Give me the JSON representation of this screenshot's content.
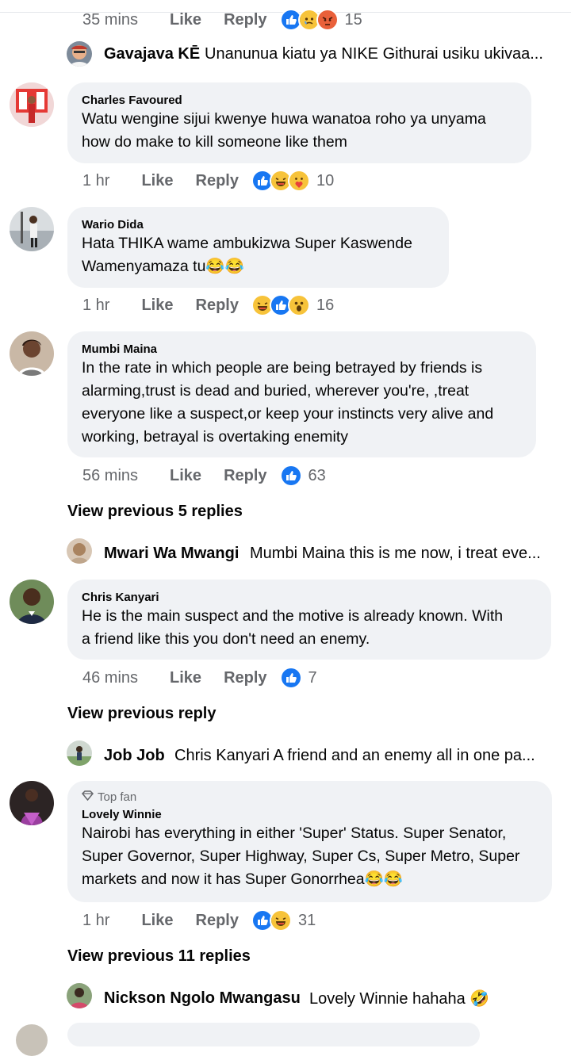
{
  "comments": [
    {
      "id": "charles",
      "name": "Charles Favoured",
      "text": "Watu wengine sijui kwenye huwa wanatoa roho ya unyama\nhow do make to kill someone like them",
      "time": "1 hr",
      "like": "Like",
      "reply": "Reply",
      "reactions": [
        "like-reaction",
        "haha-reaction",
        "care-reaction"
      ],
      "count": "10"
    },
    {
      "id": "wario",
      "name": "Wario Dida",
      "text": "Hata THIKA wame ambukizwa Super Kaswende\nWamenyamaza tu😂😂",
      "time": "1 hr",
      "like": "Like",
      "reply": "Reply",
      "reactions": [
        "haha-reaction",
        "like-reaction",
        "wow-reaction"
      ],
      "count": "16"
    },
    {
      "id": "mumbi",
      "name": "Mumbi Maina",
      "text": "In the rate in which people are being betrayed by friends is\nalarming,trust is dead and buried, wherever you're, ,treat\neveryone like a suspect,or keep your instincts very alive and\nworking, betrayal is overtaking enemity",
      "time": "56 mins",
      "like": "Like",
      "reply": "Reply",
      "reactions": [
        "like-reaction"
      ],
      "count": "63"
    },
    {
      "id": "chris",
      "name": "Chris Kanyari",
      "text": "He is the main suspect and the motive is already known. With\na friend like this you don't need an enemy.",
      "time": "46 mins",
      "like": "Like",
      "reply": "Reply",
      "reactions": [
        "like-reaction"
      ],
      "count": "7"
    },
    {
      "id": "winnie",
      "badge": "Top fan",
      "name": "Lovely Winnie",
      "text": "Nairobi has everything in either 'Super' Status. Super Senator,\nSuper Governor, Super Highway, Super Cs, Super Metro, Super\nmarkets and now it has Super Gonorrhea😂😂",
      "time": "1 hr",
      "like": "Like",
      "reply": "Reply",
      "reactions": [
        "like-reaction",
        "haha-reaction"
      ],
      "count": "31"
    }
  ],
  "top_meta": {
    "time": "35 mins",
    "like": "Like",
    "reply": "Reply",
    "reactions": [
      "like-reaction",
      "sad-reaction",
      "angry-reaction"
    ],
    "count": "15"
  },
  "replies": [
    {
      "name": "Gavajava KĒ",
      "text": "Unanunua kiatu ya NIKE Githurai usiku ukivaa..."
    },
    {
      "name": "Mwari Wa Mwangi",
      "text": "Mumbi Maina this is me now, i treat eve..."
    },
    {
      "name": "Job Job",
      "text": "Chris Kanyari A friend and an enemy all in one pa..."
    },
    {
      "name": "Nickson Ngolo Mwangasu",
      "text": "Lovely Winnie hahaha 🤣"
    }
  ],
  "view_previous": [
    "View previous 5 replies",
    "View previous reply",
    "View previous 11 replies"
  ],
  "colors": {
    "bubble": "#f0f2f5",
    "meta": "#65676b",
    "like": "#1877f2",
    "text": "#050505"
  }
}
